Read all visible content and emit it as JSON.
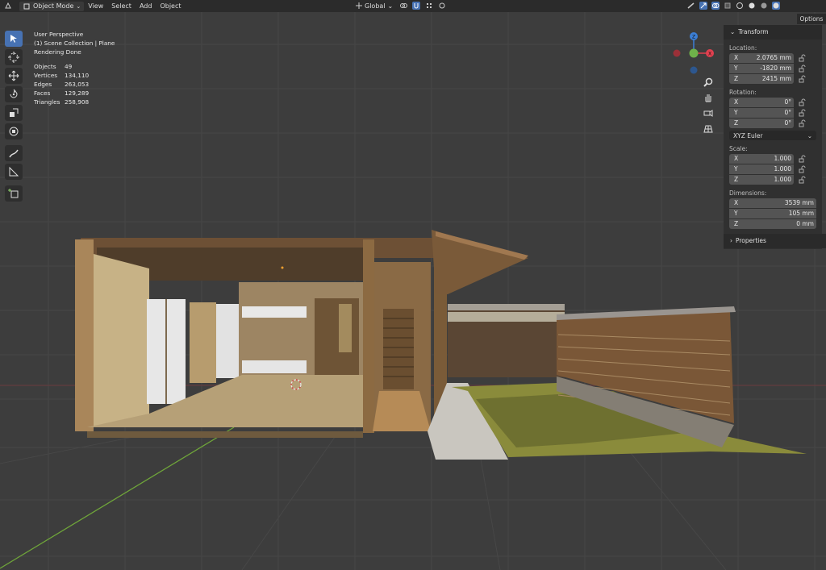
{
  "header": {
    "mode_label": "Object Mode",
    "menu_view": "View",
    "menu_select": "Select",
    "menu_add": "Add",
    "menu_object": "Object",
    "transform_orientation": "Global",
    "options_label": "Options"
  },
  "overlay": {
    "view_name": "User Perspective",
    "collection_info": "(1) Scene Collection | Plane",
    "status": "Rendering Done",
    "stats": [
      {
        "label": "Objects",
        "value": "49"
      },
      {
        "label": "Vertices",
        "value": "134,110"
      },
      {
        "label": "Edges",
        "value": "263,053"
      },
      {
        "label": "Faces",
        "value": "129,289"
      },
      {
        "label": "Triangles",
        "value": "258,908"
      }
    ]
  },
  "gizmo": {
    "x_label": "X",
    "z_label": "Z"
  },
  "npanel": {
    "transform_title": "Transform",
    "location_label": "Location:",
    "location": [
      {
        "axis": "X",
        "value": "2.0765 mm"
      },
      {
        "axis": "Y",
        "value": "-1820 mm"
      },
      {
        "axis": "Z",
        "value": "2415 mm"
      }
    ],
    "rotation_label": "Rotation:",
    "rotation": [
      {
        "axis": "X",
        "value": "0°"
      },
      {
        "axis": "Y",
        "value": "0°"
      },
      {
        "axis": "Z",
        "value": "0°"
      }
    ],
    "rotation_mode": "XYZ Euler",
    "scale_label": "Scale:",
    "scale": [
      {
        "axis": "X",
        "value": "1.000"
      },
      {
        "axis": "Y",
        "value": "1.000"
      },
      {
        "axis": "Z",
        "value": "1.000"
      }
    ],
    "dimensions_label": "Dimensions:",
    "dimensions": [
      {
        "axis": "X",
        "value": "3539 mm"
      },
      {
        "axis": "Y",
        "value": "105 mm"
      },
      {
        "axis": "Z",
        "value": "0 mm"
      }
    ],
    "properties_title": "Properties"
  },
  "colors": {
    "active_tool": "#4772b3",
    "axis_x": "#e0404f",
    "axis_y": "#6fb14a",
    "axis_z": "#3c7fd6"
  }
}
